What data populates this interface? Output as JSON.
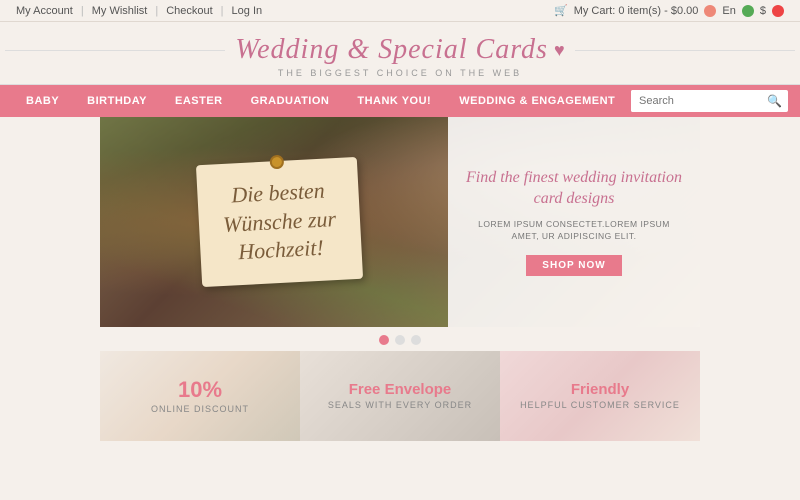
{
  "topbar": {
    "links": [
      "My Account",
      "My Wishlist",
      "Checkout",
      "Log In"
    ],
    "cart_text": "My Cart: 0 item(s) - $0.00",
    "lang": "En",
    "currency": "$"
  },
  "header": {
    "title": "Wedding & Special Cards",
    "subtitle": "THE BIGGEST CHOICE ON THE WEB"
  },
  "nav": {
    "items": [
      "BABY",
      "BIRTHDAY",
      "EASTER",
      "GRADUATION",
      "THANK YOU!",
      "WEDDING & ENGAGEMENT"
    ],
    "search_placeholder": "Search"
  },
  "hero": {
    "tag_line1": "Die besten",
    "tag_line2": "Wünsche zur",
    "tag_line3": "Hochzeit!",
    "right_title": "Find the finest wedding invitation card designs",
    "right_body": "LOREM IPSUM CONSECTET.LOREM IPSUM AMET, UR ADIPISCING ELIT.",
    "shop_now": "SHOP NOW"
  },
  "dots": [
    {
      "active": true
    },
    {
      "active": false
    },
    {
      "active": false
    }
  ],
  "promo_cards": [
    {
      "main": "10%",
      "sub": "ONLINE DISCOUNT"
    },
    {
      "main": "Free Envelope",
      "sub": "SEALS WITH EVERY ORDER"
    },
    {
      "main": "Friendly",
      "sub": "HELPFUL CUSTOMER SERVICE"
    }
  ]
}
